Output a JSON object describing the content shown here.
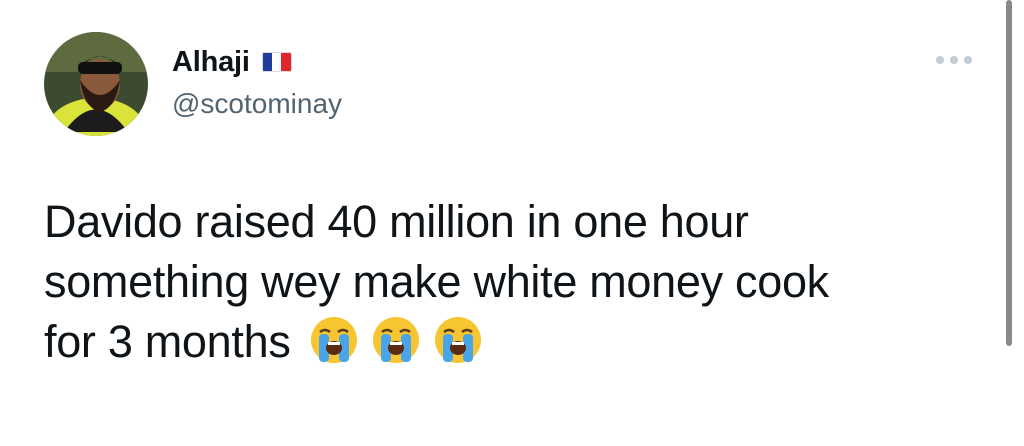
{
  "author": {
    "display_name": "Alhaji",
    "handle": "@scotominay",
    "flag": "france-flag",
    "avatar": "avatar-photo"
  },
  "tweet": {
    "lines": [
      "Davido raised 40 million in one hour",
      "something wey make white money cook",
      "for 3 months"
    ],
    "emojis": [
      "loudly-crying-face-emoji",
      "loudly-crying-face-emoji",
      "loudly-crying-face-emoji"
    ]
  },
  "actions": {
    "more_icon": "more-horizontal-icon"
  },
  "colors": {
    "text": "#0f1419",
    "secondary": "#536471",
    "flag_blue": "#1f3e9c",
    "flag_white": "#ffffff",
    "flag_red": "#e0262e",
    "emoji_yellow": "#f7c531",
    "emoji_tears": "#4aa5e8"
  }
}
